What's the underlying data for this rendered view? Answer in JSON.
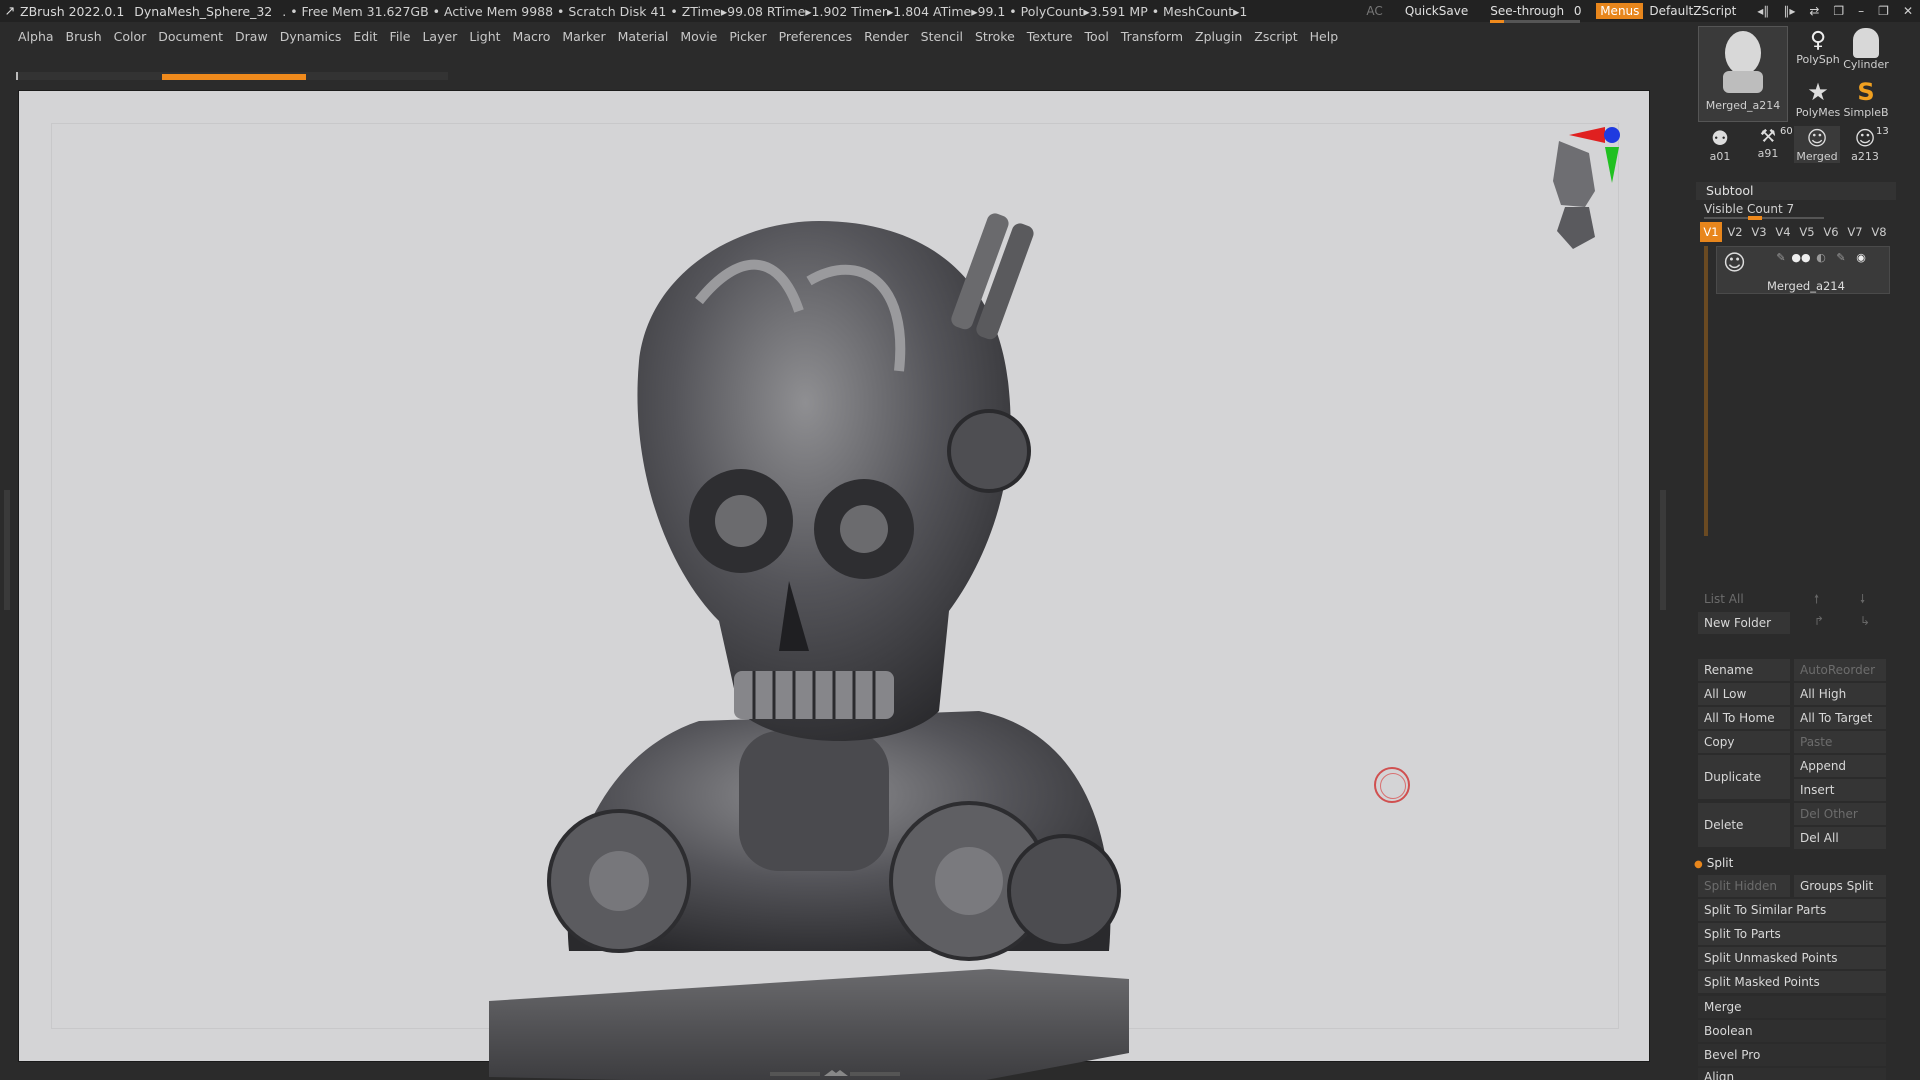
{
  "titlebar": {
    "app": "ZBrush 2022.0.1",
    "file": "DynaMesh_Sphere_32",
    "status": ". • Free Mem 31.627GB • Active Mem 9988 • Scratch Disk 41 •  ZTime▸99.08 RTime▸1.902 Timer▸1.804 ATime▸99.1 • PolyCount▸3.591 MP  • MeshCount▸1",
    "ac": "AC",
    "quicksave": "QuickSave",
    "seethrough_label": "See-through",
    "seethrough_value": "0",
    "seethrough_level": 0.0,
    "menus": "Menus",
    "script": "DefaultZScript",
    "accent_color": "#e8861c"
  },
  "menubar": [
    "Alpha",
    "Brush",
    "Color",
    "Document",
    "Draw",
    "Dynamics",
    "Edit",
    "File",
    "Layer",
    "Light",
    "Macro",
    "Marker",
    "Material",
    "Movie",
    "Picker",
    "Preferences",
    "Render",
    "Stencil",
    "Stroke",
    "Texture",
    "Tool",
    "Transform",
    "Zplugin",
    "Zscript",
    "Help"
  ],
  "tools": {
    "current": "Merged_a214",
    "polysphere": "PolySph",
    "cylinder": "Cylinder",
    "polymesh": "PolyMes",
    "simpleb": "SimpleB",
    "a01": "a01",
    "a91": "a91",
    "merged": "Merged",
    "a213": "a213",
    "badge_60": "60",
    "badge_13": "13"
  },
  "subtool": {
    "title": "Subtool",
    "visible_count": "Visible Count 7",
    "versions": [
      "V1",
      "V2",
      "V3",
      "V4",
      "V5",
      "V6",
      "V7",
      "V8"
    ],
    "active_version": "V1",
    "item_name": "Merged_a214",
    "list_all": "List All",
    "new_folder": "New Folder",
    "rename": "Rename",
    "autoreorder": "AutoReorder",
    "all_low": "All Low",
    "all_high": "All High",
    "all_to_home": "All To Home",
    "all_to_target": "All To Target",
    "copy": "Copy",
    "paste": "Paste",
    "duplicate": "Duplicate",
    "append": "Append",
    "insert": "Insert",
    "delete": "Delete",
    "del_other": "Del Other",
    "del_all": "Del All",
    "split": "Split",
    "split_hidden": "Split Hidden",
    "groups_split": "Groups Split",
    "split_similar": "Split To Similar Parts",
    "split_parts": "Split To Parts",
    "split_unmasked": "Split Unmasked Points",
    "split_masked": "Split Masked Points",
    "merge": "Merge",
    "boolean": "Boolean",
    "bevel_pro": "Bevel Pro",
    "align": "Align"
  },
  "canvas": {
    "background": "#d4d4d6",
    "brush_color": "#d05050"
  }
}
